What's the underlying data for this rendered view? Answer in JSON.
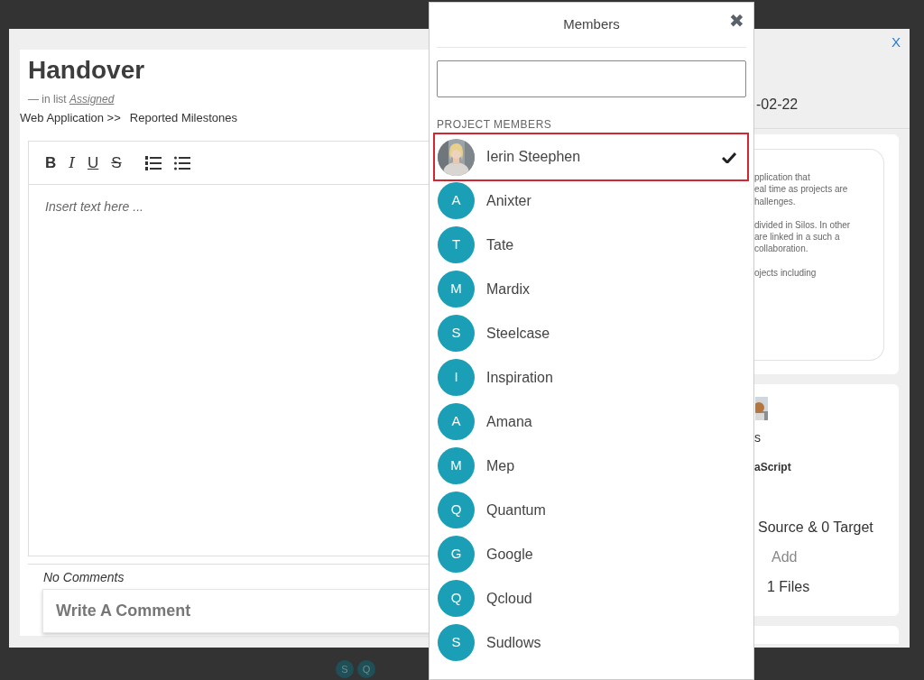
{
  "modal": {
    "close": "X"
  },
  "card": {
    "title": "Handover",
    "list_prefix": "— in list",
    "list_name": "Assigned",
    "breadcrumb": [
      "Web Application >>",
      "Reported Milestones"
    ],
    "toolbar": [
      {
        "kind": "bold",
        "label": "B"
      },
      {
        "kind": "italic",
        "label": "I"
      },
      {
        "kind": "underline",
        "label": "U"
      },
      {
        "kind": "strike",
        "label": "S"
      },
      {
        "kind": "ordered-list"
      },
      {
        "kind": "bullet-list"
      }
    ],
    "editor": {
      "placeholder": "Insert text here ..."
    },
    "comments_status": "No Comments",
    "comment": {
      "placeholder": "Write A Comment"
    }
  },
  "details": {
    "date": "-02-22",
    "description": [
      [
        "pplication that",
        "eal time as projects are",
        "hallenges."
      ],
      [
        "divided in Silos. In other",
        "are linked in a such a",
        "collaboration."
      ],
      [
        "ojects including"
      ]
    ],
    "tech_label": "s",
    "tech": "aScript",
    "links": "Source & 0 Target",
    "add": "Add",
    "files": "1 Files"
  },
  "background_avatars": [
    "S",
    "Q"
  ],
  "members_popover": {
    "title": "Members",
    "close": "✖",
    "section": "PROJECT MEMBERS",
    "members": [
      {
        "name": "Ierin Steephen",
        "selected": true
      },
      {
        "kind": "initial",
        "initial": "A",
        "name": "Anixter",
        "selected": false
      },
      {
        "kind": "initial",
        "initial": "T",
        "name": "Tate",
        "selected": false
      },
      {
        "kind": "initial",
        "initial": "M",
        "name": "Mardix",
        "selected": false
      },
      {
        "kind": "initial",
        "initial": "S",
        "name": "Steelcase",
        "selected": false
      },
      {
        "kind": "initial",
        "initial": "I",
        "name": "Inspiration",
        "selected": false
      },
      {
        "kind": "initial",
        "initial": "A",
        "name": "Amana",
        "selected": false
      },
      {
        "kind": "initial",
        "initial": "M",
        "name": "Mep",
        "selected": false
      },
      {
        "kind": "initial",
        "initial": "Q",
        "name": "Quantum",
        "selected": false
      },
      {
        "kind": "initial",
        "initial": "G",
        "name": "Google",
        "selected": false
      },
      {
        "kind": "initial",
        "initial": "Q",
        "name": "Qcloud",
        "selected": false
      },
      {
        "kind": "initial",
        "initial": "S",
        "name": "Sudlows",
        "selected": false
      }
    ]
  }
}
